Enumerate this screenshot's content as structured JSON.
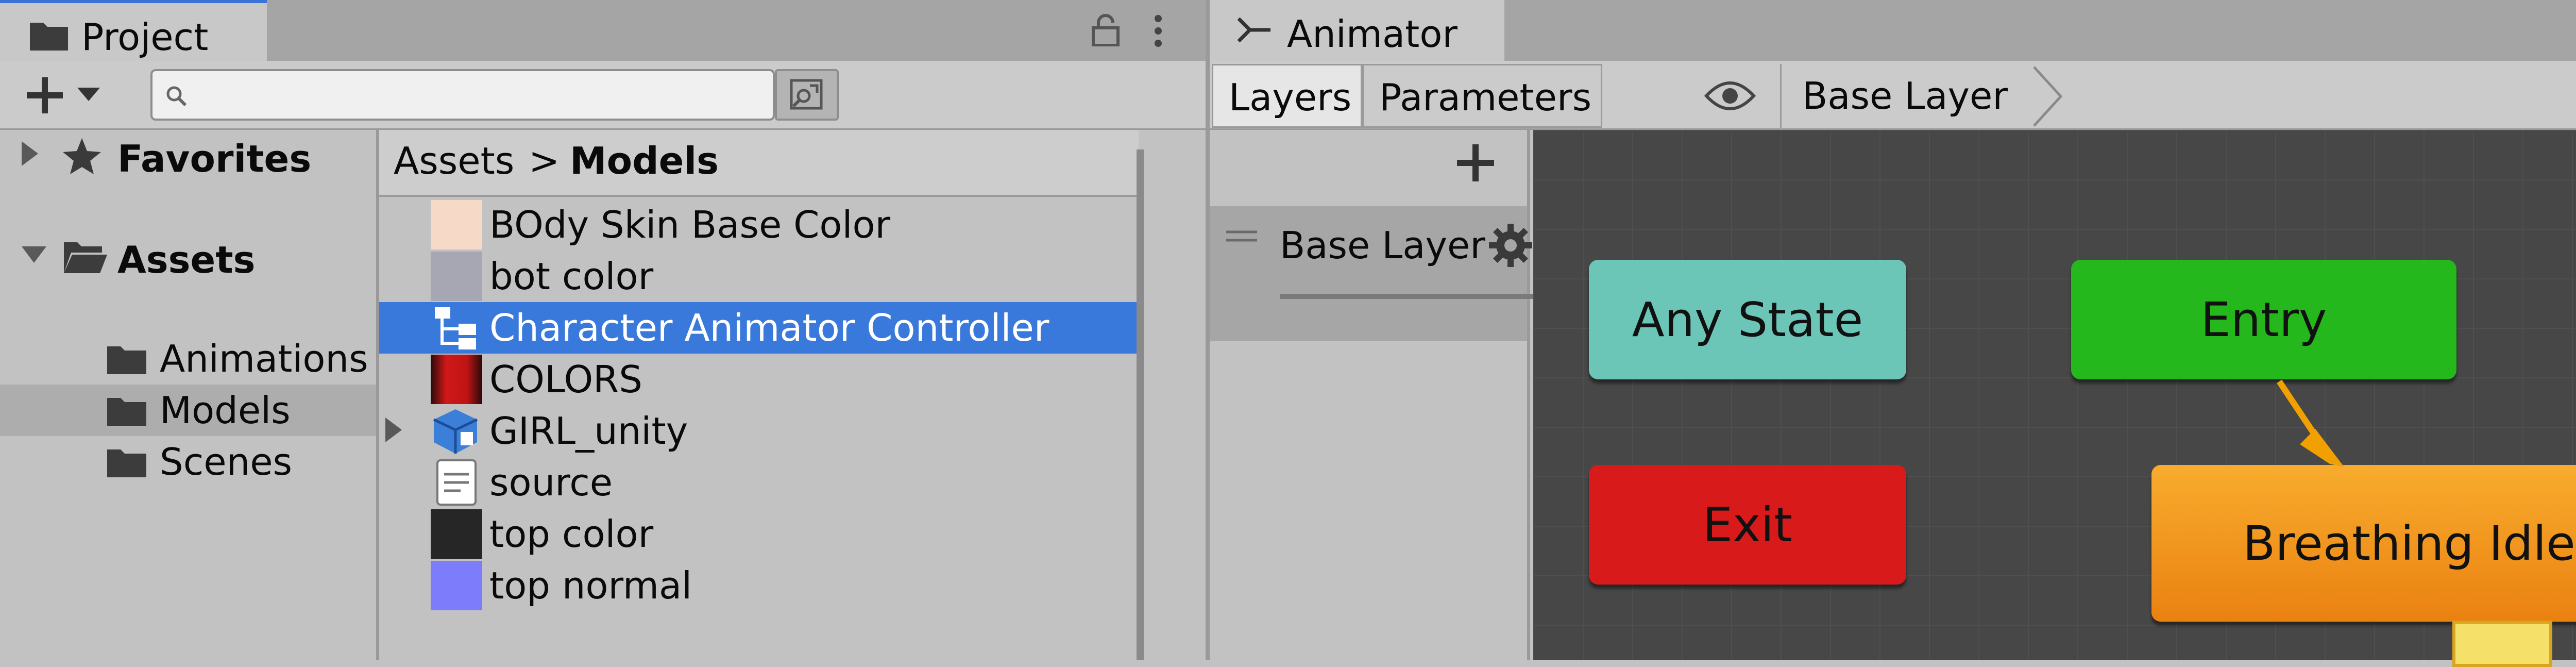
{
  "project": {
    "tab_title": "Project",
    "icons": [
      "folder-icon",
      "lock-icon",
      "kebab-menu-icon",
      "plus-icon",
      "dropdown-arrow-icon",
      "search-icon",
      "search-filter-icon"
    ],
    "search": {
      "value": "",
      "placeholder": ""
    },
    "tree": {
      "favorites_label": "Favorites",
      "assets_label": "Assets",
      "children": [
        "Animations",
        "Models",
        "Scenes"
      ],
      "selected": "Models"
    },
    "breadcrumb": {
      "root": "Assets",
      "separator": ">",
      "current": "Models"
    },
    "files": [
      {
        "name": "BOdy Skin Base Color",
        "thumb_color": "#f7d9c8",
        "icon": "texture-thumbnail"
      },
      {
        "name": "bot color",
        "thumb_color": "#a7a7b4",
        "icon": "texture-thumbnail"
      },
      {
        "name": "Character Animator Controller",
        "thumb_color": "",
        "icon": "animator-controller-icon",
        "selected": true
      },
      {
        "name": "COLORS",
        "thumb_color": "#c01414",
        "icon": "texture-thumbnail"
      },
      {
        "name": "GIRL_unity",
        "thumb_color": "#3b7fd8",
        "icon": "model-prefab-icon",
        "expandable": true
      },
      {
        "name": "source",
        "thumb_color": "#ffffff",
        "icon": "text-file-icon"
      },
      {
        "name": "top color",
        "thumb_color": "#262626",
        "icon": "texture-thumbnail"
      },
      {
        "name": "top normal",
        "thumb_color": "#7d7dfb",
        "icon": "texture-thumbnail"
      }
    ]
  },
  "animator": {
    "tab_title": "Animator",
    "tabs": [
      "Layers",
      "Parameters"
    ],
    "active_tab": "Layers",
    "breadcrumb_layer": "Base Layer",
    "layers": [
      {
        "name": "Base Layer"
      }
    ],
    "states": {
      "any_state": {
        "label": "Any State",
        "color": "#6cc6b7"
      },
      "entry": {
        "label": "Entry",
        "color": "#25b81d"
      },
      "exit": {
        "label": "Exit",
        "color": "#d81a1a"
      },
      "default_state": {
        "label": "Breathing Idle",
        "color": "#f59a1c"
      }
    },
    "transition_color": "#f0a000"
  }
}
